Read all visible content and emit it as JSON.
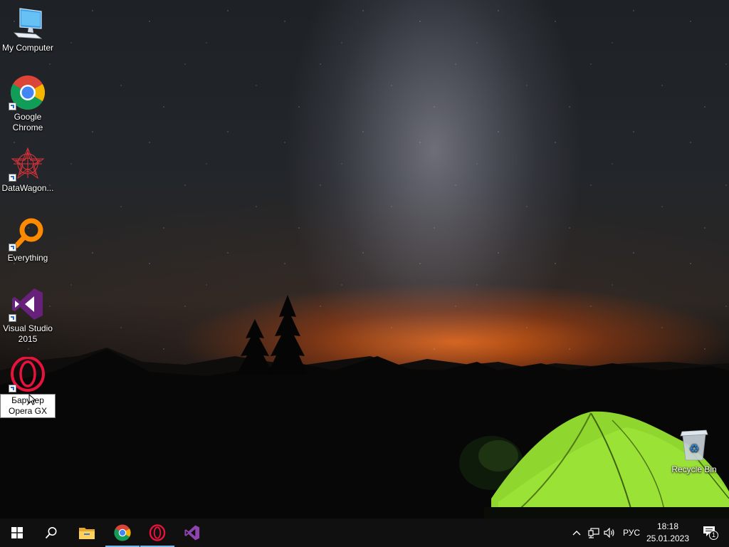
{
  "desktop": {
    "icons": [
      {
        "label": "My Computer"
      },
      {
        "label": "Google Chrome"
      },
      {
        "label": "DataWagon..."
      },
      {
        "label": "Everything"
      },
      {
        "label": "Visual Studio 2015"
      },
      {
        "label": "Барузер Opera GX"
      }
    ],
    "recycle_bin": {
      "label": "Recycle Bin"
    }
  },
  "taskbar": {
    "pinned": [
      "file-explorer-icon",
      "chrome-icon",
      "opera-icon",
      "visual-studio-icon"
    ],
    "language": "РУС",
    "time": "18:18",
    "date": "25.01.2023",
    "notification_count": "1"
  },
  "colors": {
    "taskbar": "#101010",
    "active_indicator": "#76b9ed",
    "tent": "#9be23c"
  }
}
